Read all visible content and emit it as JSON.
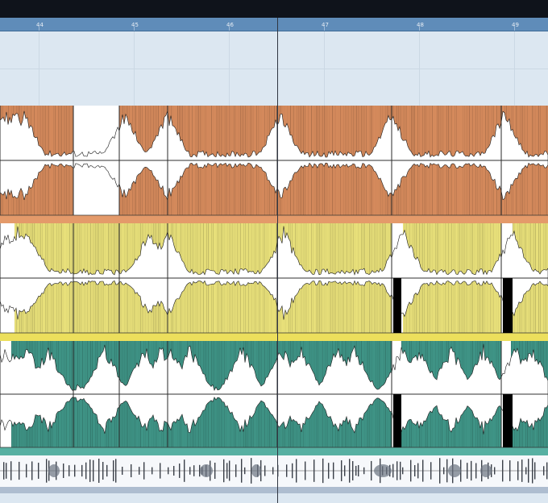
{
  "ruler": {
    "bars": [
      "44",
      "45",
      "46",
      "47",
      "48",
      "49"
    ]
  },
  "tracks": [
    {
      "id": "track-1",
      "color": "#d58a5c",
      "footer": "#e49a6a"
    },
    {
      "id": "track-2",
      "color": "#e8e07a",
      "footer": "#ecdf5c"
    },
    {
      "id": "track-3",
      "color": "#3f9486",
      "footer": "#57b0a2"
    },
    {
      "id": "track-4",
      "color": "#f6f8fb"
    }
  ]
}
